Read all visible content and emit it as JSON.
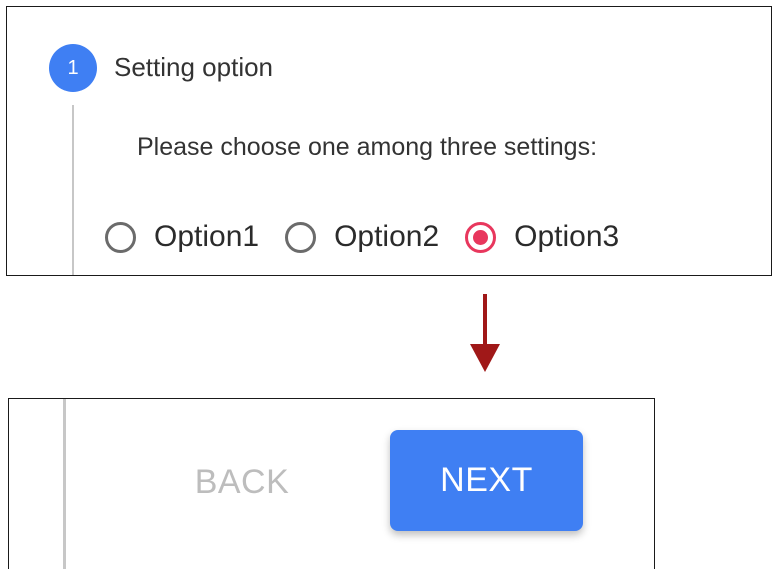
{
  "step": {
    "number": "1",
    "title": "Setting option",
    "prompt": "Please choose one among three settings:"
  },
  "options": [
    {
      "label": "Option1",
      "selected": false
    },
    {
      "label": "Option2",
      "selected": false
    },
    {
      "label": "Option3",
      "selected": true
    }
  ],
  "navigation": {
    "back_label": "BACK",
    "next_label": "NEXT"
  },
  "colors": {
    "accent": "#3f7ff3",
    "radio_selected": "#e8375d",
    "arrow": "#a01818",
    "disabled_text": "#bdbdbd"
  },
  "icons": {
    "transition": "arrow-down-icon"
  }
}
